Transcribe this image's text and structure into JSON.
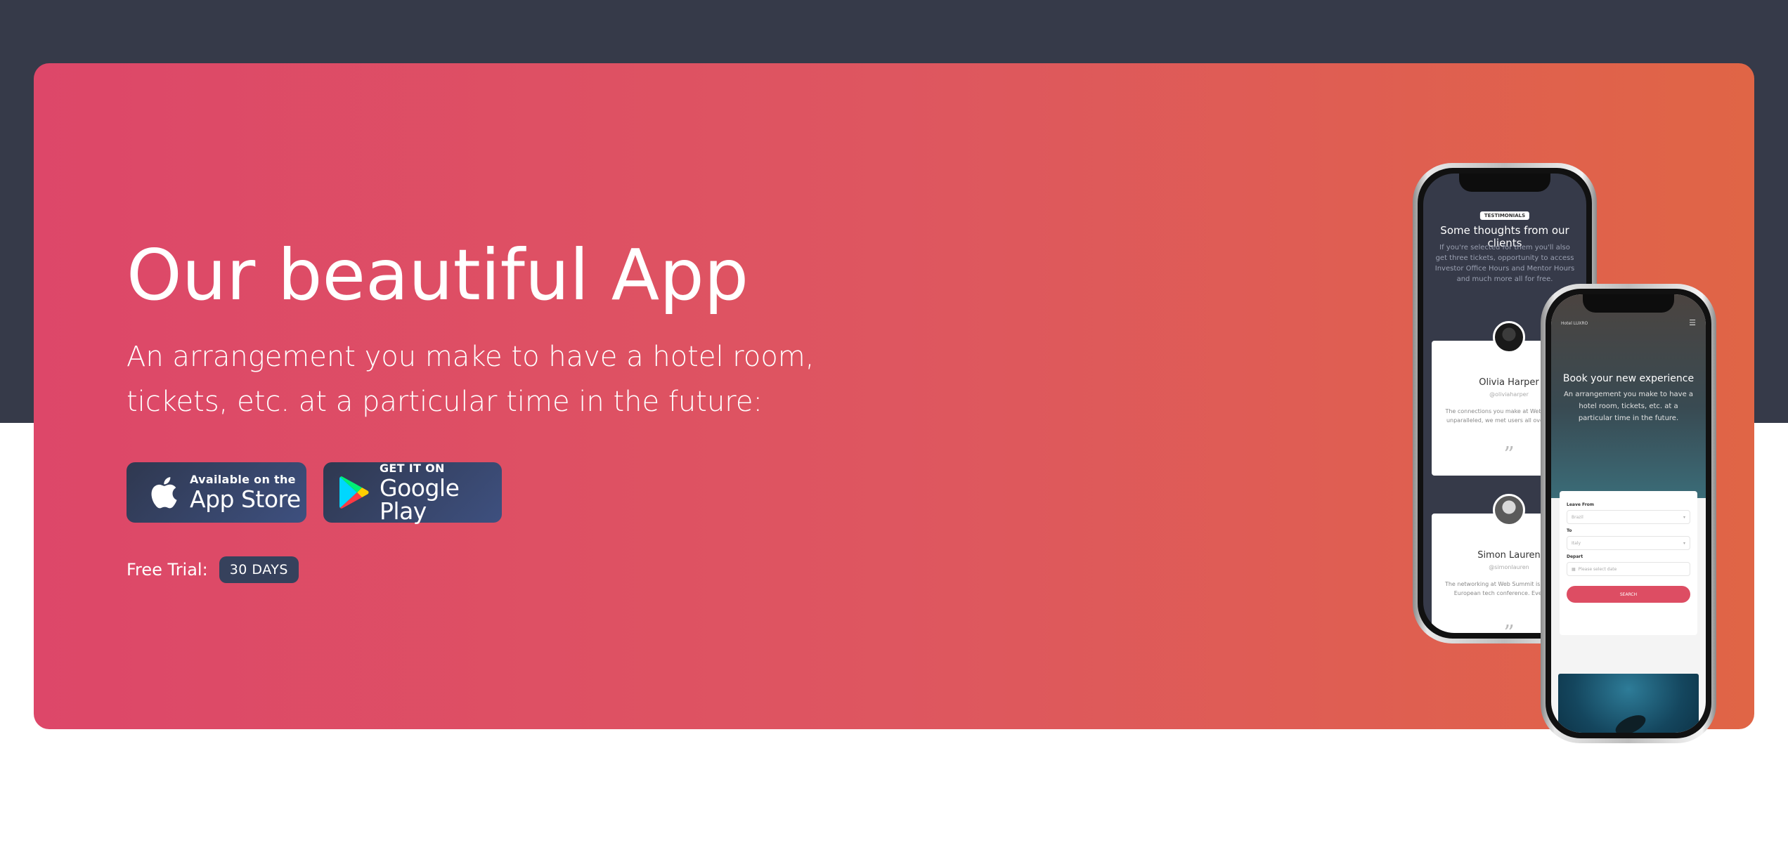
{
  "hero": {
    "title": "Our beautiful App",
    "subtitle": "An arrangement you make to have a hotel room, tickets, etc. at a particular time in the future:",
    "app_store": {
      "small": "Available on the",
      "big": "App Store",
      "icon": "apple-icon"
    },
    "google_play": {
      "small": "GET IT ON",
      "big": "Google Play",
      "icon": "google-play-icon"
    },
    "trial_label": "Free Trial:",
    "trial_badge": "30 DAYS"
  },
  "phone_back": {
    "tag": "TESTIMONIALS",
    "heading": "Some thoughts from our clients",
    "subtext": "If you're selected for them you'll also get three tickets, opportunity to access Investor Office Hours and Mentor Hours and much more all for free.",
    "cards": [
      {
        "name": "Olivia Harper",
        "handle": "@oliviaharper",
        "text": "The connections you make at Web Summit are unparalleled, we met users all over the world."
      },
      {
        "name": "Simon Lauren",
        "handle": "@simonlauren",
        "text": "The networking at Web Summit is like no other European tech conference. Everything is"
      }
    ]
  },
  "phone_front": {
    "brand": "Hotel LUXRO",
    "title": "Book your new experience",
    "subtitle": "An arrangement you make to have a hotel room, tickets, etc. at a particular time in the future.",
    "form": {
      "leave_label": "Leave From",
      "leave_value": "Brazil",
      "to_label": "To",
      "to_value": "Italy",
      "depart_label": "Depart",
      "depart_placeholder": "Please select date",
      "search_label": "SEARCH"
    }
  },
  "colors": {
    "dark_band": "#363a49",
    "gradient_start": "#dd4769",
    "gradient_end": "#e06546",
    "store_button": "#34405e",
    "accent": "#dd4d63"
  }
}
